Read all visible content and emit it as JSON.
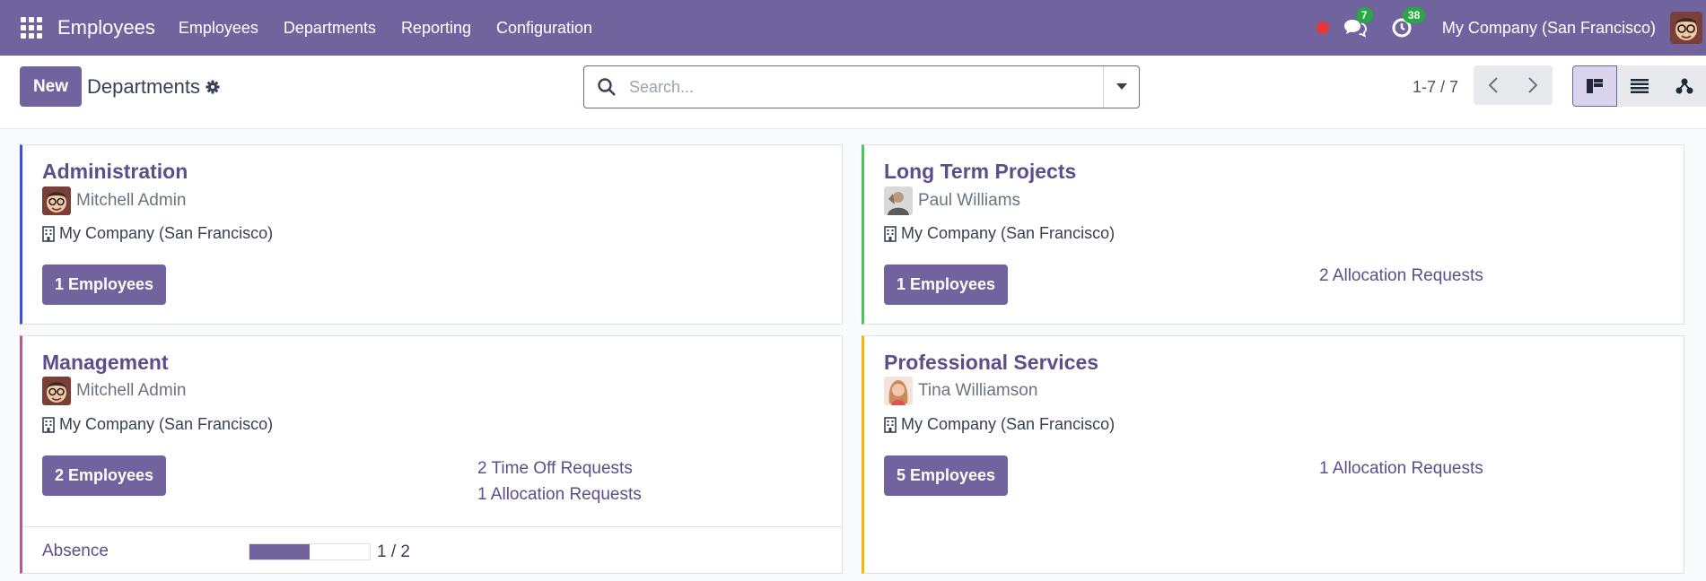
{
  "navbar": {
    "brand": "Employees",
    "menu": [
      "Employees",
      "Departments",
      "Reporting",
      "Configuration"
    ],
    "messages_count": "7",
    "activities_count": "38",
    "company": "My Company (San Francisco)"
  },
  "control": {
    "new_label": "New",
    "breadcrumb": "Departments",
    "search_placeholder": "Search...",
    "pager": "1-7 / 7"
  },
  "colors": {
    "brand": "#71639e",
    "badge": "#28a745",
    "recording": "#e5383b",
    "administration_stripe": "#3b4fe4",
    "long_term_stripe": "#4fc35a",
    "management_stripe": "#b55a96",
    "professional_stripe": "#f2b705"
  },
  "cards": [
    {
      "title": "Administration",
      "manager": "Mitchell Admin",
      "company": "My Company (San Francisco)",
      "employees_label": "1 Employees",
      "requests": []
    },
    {
      "title": "Long Term Projects",
      "manager": "Paul Williams",
      "company": "My Company (San Francisco)",
      "employees_label": "1 Employees",
      "requests": [
        "2 Allocation Requests"
      ]
    },
    {
      "title": "Management",
      "manager": "Mitchell Admin",
      "company": "My Company (San Francisco)",
      "employees_label": "2 Employees",
      "requests": [
        "2 Time Off Requests",
        "1 Allocation Requests"
      ],
      "absence": {
        "label": "Absence",
        "value": 1,
        "total": 2,
        "text": "1 / 2"
      }
    },
    {
      "title": "Professional Services",
      "manager": "Tina Williamson",
      "company": "My Company (San Francisco)",
      "employees_label": "5 Employees",
      "requests": [
        "1 Allocation Requests"
      ]
    }
  ]
}
